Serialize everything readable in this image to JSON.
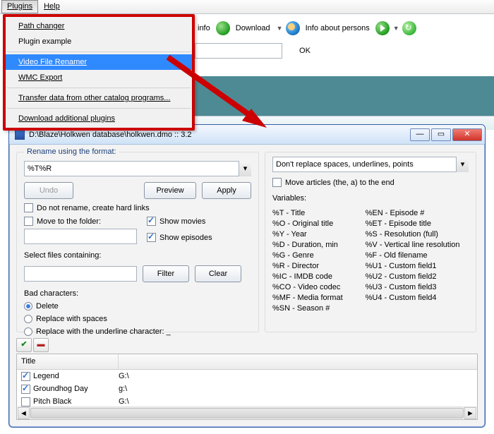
{
  "menubar": {
    "plugins": "Plugins",
    "help": "Help"
  },
  "menu": {
    "items": [
      "Path changer",
      "Plugin example",
      "Video File Renamer",
      "WMC Export",
      "Transfer data from other catalog programs...",
      "Download additional plugins"
    ]
  },
  "toolbar": {
    "info": "info",
    "download": "Download",
    "info_persons": "Info about persons",
    "ok": "OK"
  },
  "dialog": {
    "title": "D:\\Blaze\\Holkwen database\\holkwen.dmo :: 3.2",
    "group": "Rename using the format:",
    "format_value": "%T%R",
    "undo": "Undo",
    "preview": "Preview",
    "apply": "Apply",
    "no_rename": "Do not rename, create hard links",
    "move_folder": "Move to the folder:",
    "show_movies": "Show movies",
    "show_episodes": "Show episodes",
    "select_files": "Select files containing:",
    "filter": "Filter",
    "clear": "Clear",
    "bad_chars": "Bad characters:",
    "bc_delete": "Delete",
    "bc_spaces": "Replace with spaces",
    "bc_underline": "Replace with the underline character: _",
    "spaces_combo": "Don't replace spaces, underlines, points",
    "move_articles": "Move articles (the, a) to the end",
    "variables_label": "Variables:",
    "vars_left": [
      "%T - Title",
      "%O - Original title",
      "%Y - Year",
      "%D - Duration, min",
      "%G - Genre",
      "%R - Director",
      "%IC - IMDB code",
      "%CO - Video codec",
      "%MF - Media format",
      "%SN - Season #"
    ],
    "vars_right": [
      "%EN - Episode #",
      "%ET - Episode title",
      "%S - Resolution (full)",
      "%V - Vertical line resolution",
      "%F - Old filename",
      "%U1 - Custom field1",
      "%U2 - Custom field2",
      "%U3 - Custom field3",
      "%U4 - Custom field4"
    ],
    "list": {
      "col_title": "Title",
      "rows": [
        {
          "checked": true,
          "title": "Legend",
          "path": "G:\\"
        },
        {
          "checked": true,
          "title": "Groundhog Day",
          "path": "g:\\"
        },
        {
          "checked": false,
          "title": "Pitch Black",
          "path": "G:\\"
        }
      ]
    }
  }
}
